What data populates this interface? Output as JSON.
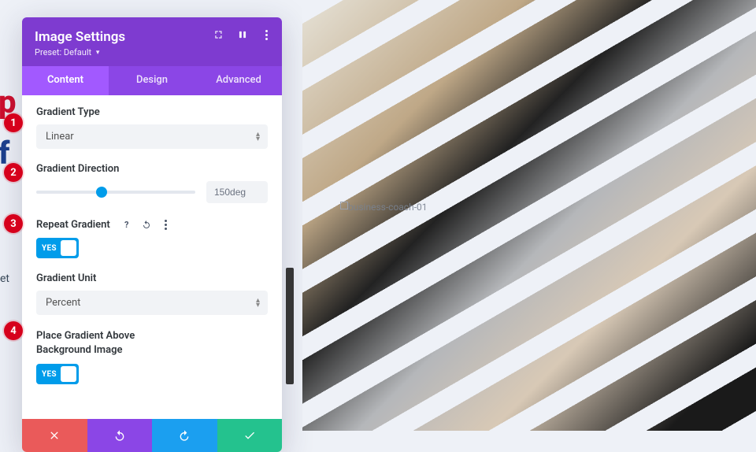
{
  "panel": {
    "title": "Image Settings",
    "preset_label": "Preset: Default"
  },
  "tabs": {
    "content": "Content",
    "design": "Design",
    "advanced": "Advanced"
  },
  "fields": {
    "gradient_type": {
      "label": "Gradient Type",
      "value": "Linear"
    },
    "gradient_direction": {
      "label": "Gradient Direction",
      "value": "150deg",
      "slider_percent": 41
    },
    "repeat_gradient": {
      "label": "Repeat Gradient",
      "toggle_label": "YES"
    },
    "gradient_unit": {
      "label": "Gradient Unit",
      "value": "Percent"
    },
    "place_above": {
      "label_line1": "Place Gradient Above",
      "label_line2": "Background Image",
      "toggle_label": "YES"
    }
  },
  "annotations": [
    "1",
    "2",
    "3",
    "4"
  ],
  "preview": {
    "placeholder_text": "business-coach-01"
  },
  "sidebar_hint": {
    "et": "et"
  }
}
